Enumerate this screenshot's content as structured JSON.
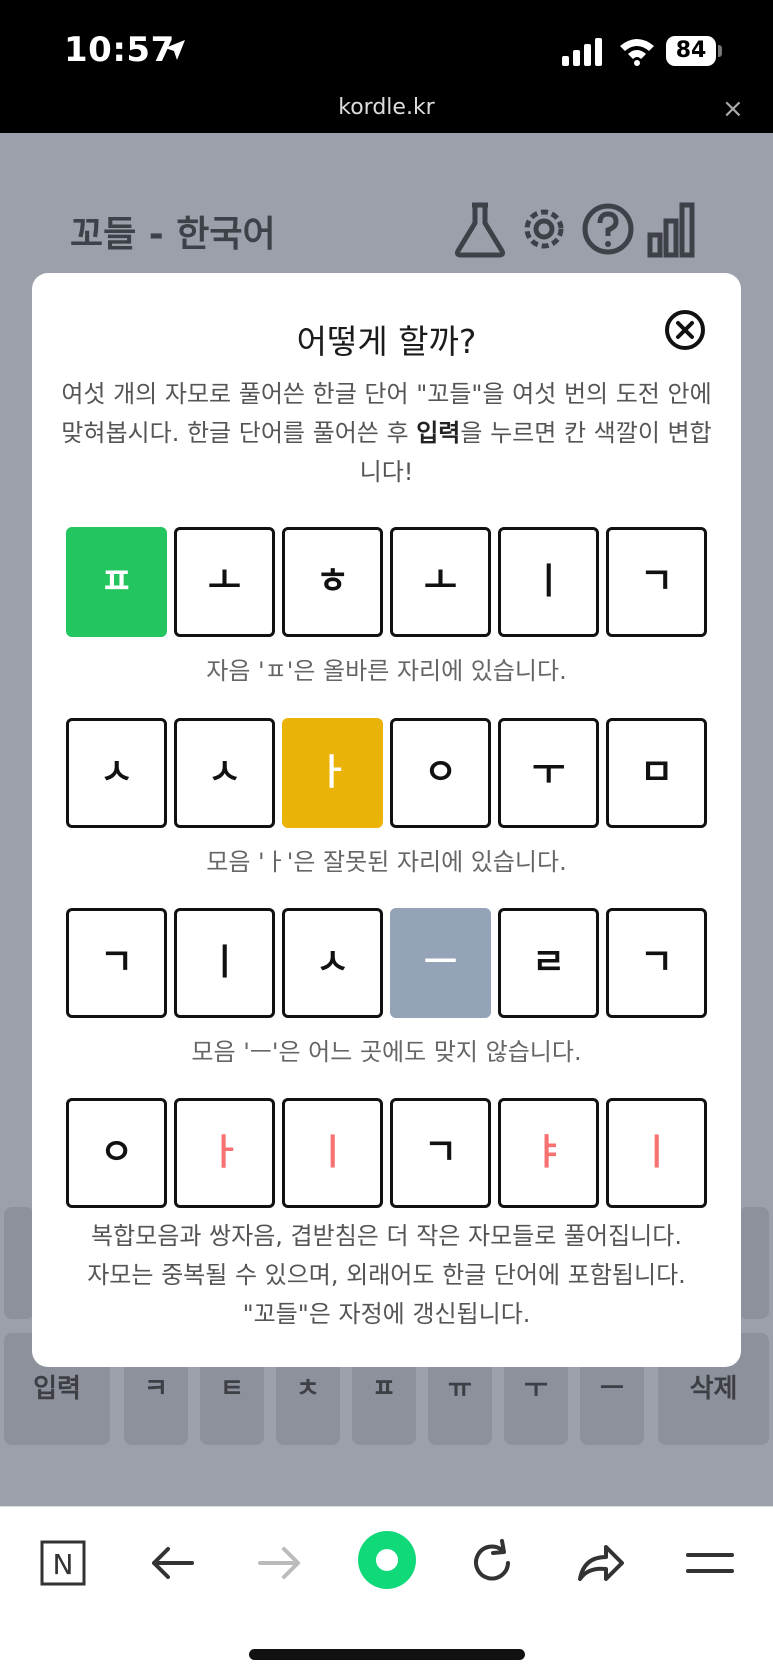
{
  "status_bar": {
    "time": "10:57",
    "battery": "84"
  },
  "browser": {
    "url": "kordle.kr",
    "close_glyph": "×"
  },
  "page": {
    "title": "꼬들 - 한국어"
  },
  "keyboard": {
    "enter_label": "입력",
    "delete_label": "삭제",
    "keys": [
      "ㅋ",
      "ㅌ",
      "ㅊ",
      "ㅍ",
      "ㅠ",
      "ㅜ",
      "ㅡ"
    ]
  },
  "modal": {
    "title": "어떻게 할까?",
    "intro_part1": "여섯 개의 자모로 풀어쓴 한글 단어 \"꼬들\"을 여섯 번의 도전 안에 맞혀봅시다. 한글 단어를 풀어쓴 후 ",
    "intro_bold": "입력",
    "intro_part2": "을 누르면 칸 색깔이 변합니다!",
    "examples": [
      {
        "tiles": [
          {
            "char": "ㅍ",
            "state": "green"
          },
          {
            "char": "ㅗ",
            "state": "empty"
          },
          {
            "char": "ㅎ",
            "state": "empty"
          },
          {
            "char": "ㅗ",
            "state": "empty"
          },
          {
            "char": "ㅣ",
            "state": "empty"
          },
          {
            "char": "ㄱ",
            "state": "empty"
          }
        ],
        "caption": "자음 'ㅍ'은 올바른 자리에 있습니다."
      },
      {
        "tiles": [
          {
            "char": "ㅅ",
            "state": "empty"
          },
          {
            "char": "ㅅ",
            "state": "empty"
          },
          {
            "char": "ㅏ",
            "state": "yellow"
          },
          {
            "char": "ㅇ",
            "state": "empty"
          },
          {
            "char": "ㅜ",
            "state": "empty"
          },
          {
            "char": "ㅁ",
            "state": "empty"
          }
        ],
        "caption": "모음 'ㅏ'은 잘못된 자리에 있습니다."
      },
      {
        "tiles": [
          {
            "char": "ㄱ",
            "state": "empty"
          },
          {
            "char": "ㅣ",
            "state": "empty"
          },
          {
            "char": "ㅅ",
            "state": "empty"
          },
          {
            "char": "ㅡ",
            "state": "gray"
          },
          {
            "char": "ㄹ",
            "state": "empty"
          },
          {
            "char": "ㄱ",
            "state": "empty"
          }
        ],
        "caption": "모음 'ㅡ'은 어느 곳에도 맞지 않습니다."
      },
      {
        "tiles": [
          {
            "char": "ㅇ",
            "state": "empty"
          },
          {
            "char": "ㅏ",
            "state": "red"
          },
          {
            "char": "ㅣ",
            "state": "red"
          },
          {
            "char": "ㄱ",
            "state": "empty"
          },
          {
            "char": "ㅑ",
            "state": "red"
          },
          {
            "char": "ㅣ",
            "state": "red"
          }
        ],
        "caption": ""
      }
    ],
    "footer_lines": [
      "복합모음과 쌍자음, 겹받침은 더 작은 자모들로 풀어집니다.",
      "자모는 중복될 수 있으며, 외래어도 한글 단어에 포함됩니다.",
      "\"꼬들\"은 자정에 갱신됩니다."
    ]
  },
  "colors": {
    "green": "#22c55e",
    "yellow": "#eab308",
    "gray": "#94a3b8",
    "red": "#f87171"
  },
  "toolbar": {
    "n_label": "N"
  }
}
